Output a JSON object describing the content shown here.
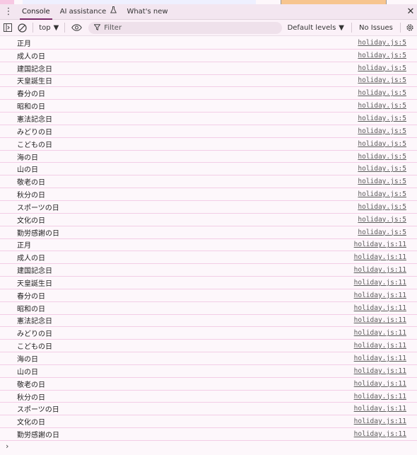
{
  "tabs": {
    "console": "Console",
    "ai_assistance": "AI assistance",
    "whats_new": "What's new"
  },
  "toolbar": {
    "context": "top",
    "filter_placeholder": "Filter",
    "levels": "Default levels",
    "issues": "No Issues"
  },
  "icons": {
    "menu": "kebab-menu-icon",
    "sidebar": "sidebar-toggle-icon",
    "clear": "clear-console-icon",
    "eye": "live-expression-icon",
    "filter": "filter-icon",
    "settings": "gear-icon",
    "close": "close-icon",
    "flask": "flask-icon"
  },
  "colors": {
    "accent": "#7a2b69",
    "row_divider": "#f3cde6",
    "background": "#fdf7fb"
  },
  "messages": [
    {
      "text": "正月",
      "source": "holiday.js:5"
    },
    {
      "text": "成人の日",
      "source": "holiday.js:5"
    },
    {
      "text": "建国記念日",
      "source": "holiday.js:5"
    },
    {
      "text": "天皇誕生日",
      "source": "holiday.js:5"
    },
    {
      "text": "春分の日",
      "source": "holiday.js:5"
    },
    {
      "text": "昭和の日",
      "source": "holiday.js:5"
    },
    {
      "text": "憲法記念日",
      "source": "holiday.js:5"
    },
    {
      "text": "みどりの日",
      "source": "holiday.js:5"
    },
    {
      "text": "こどもの日",
      "source": "holiday.js:5"
    },
    {
      "text": "海の日",
      "source": "holiday.js:5"
    },
    {
      "text": "山の日",
      "source": "holiday.js:5"
    },
    {
      "text": "敬老の日",
      "source": "holiday.js:5"
    },
    {
      "text": "秋分の日",
      "source": "holiday.js:5"
    },
    {
      "text": "スポーツの日",
      "source": "holiday.js:5"
    },
    {
      "text": "文化の日",
      "source": "holiday.js:5"
    },
    {
      "text": "勤労感謝の日",
      "source": "holiday.js:5"
    },
    {
      "text": "正月",
      "source": "holiday.js:11"
    },
    {
      "text": "成人の日",
      "source": "holiday.js:11"
    },
    {
      "text": "建国記念日",
      "source": "holiday.js:11"
    },
    {
      "text": "天皇誕生日",
      "source": "holiday.js:11"
    },
    {
      "text": "春分の日",
      "source": "holiday.js:11"
    },
    {
      "text": "昭和の日",
      "source": "holiday.js:11"
    },
    {
      "text": "憲法記念日",
      "source": "holiday.js:11"
    },
    {
      "text": "みどりの日",
      "source": "holiday.js:11"
    },
    {
      "text": "こどもの日",
      "source": "holiday.js:11"
    },
    {
      "text": "海の日",
      "source": "holiday.js:11"
    },
    {
      "text": "山の日",
      "source": "holiday.js:11"
    },
    {
      "text": "敬老の日",
      "source": "holiday.js:11"
    },
    {
      "text": "秋分の日",
      "source": "holiday.js:11"
    },
    {
      "text": "スポーツの日",
      "source": "holiday.js:11"
    },
    {
      "text": "文化の日",
      "source": "holiday.js:11"
    },
    {
      "text": "勤労感謝の日",
      "source": "holiday.js:11"
    }
  ]
}
